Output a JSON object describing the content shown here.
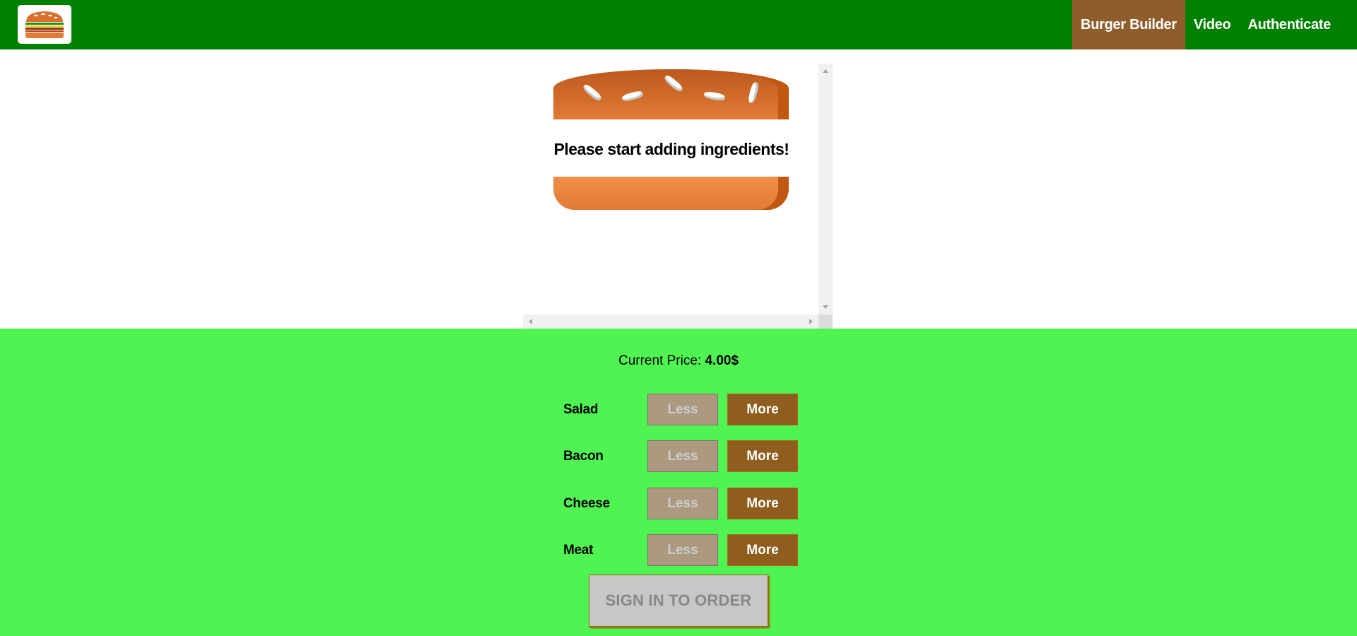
{
  "toolbar": {
    "logo_icon": "burger-logo-icon",
    "nav": [
      {
        "label": "Burger Builder",
        "active": true
      },
      {
        "label": "Video",
        "active": false
      },
      {
        "label": "Authenticate",
        "active": false
      }
    ]
  },
  "burger": {
    "prompt": "Please start adding ingredients!"
  },
  "controls": {
    "price_label": "Current Price:",
    "price_value": "4.00$",
    "ingredients": [
      {
        "label": "Salad",
        "less": "Less",
        "more": "More"
      },
      {
        "label": "Bacon",
        "less": "Less",
        "more": "More"
      },
      {
        "label": "Cheese",
        "less": "Less",
        "more": "More"
      },
      {
        "label": "Meat",
        "less": "Less",
        "more": "More"
      }
    ],
    "order_button": "SIGN IN TO ORDER"
  },
  "colors": {
    "toolbar_bg": "#008000",
    "nav_active_bg": "#8f5c2c",
    "controls_bg": "#4ff352",
    "more_button_bg": "#8f5e1e",
    "less_button_bg": "#ac9980",
    "bread_top": "#e27b36",
    "bread_shadow": "#c15711"
  }
}
